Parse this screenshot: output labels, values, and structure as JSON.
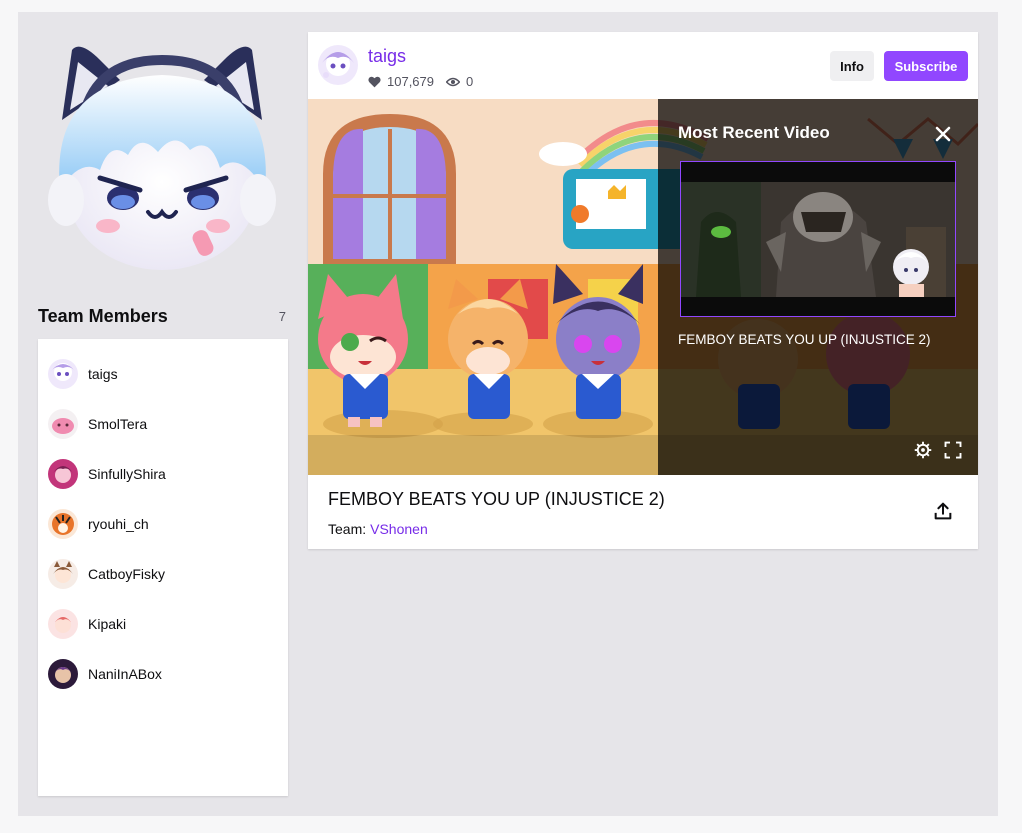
{
  "team": {
    "members_heading": "Team Members",
    "members_count": "7",
    "members": [
      {
        "name": "taigs",
        "avatar_color": "#d8c8f0"
      },
      {
        "name": "SmolTera",
        "avatar_color": "#f08bb0"
      },
      {
        "name": "SinfullyShira",
        "avatar_color": "#c2357a"
      },
      {
        "name": "ryouhi_ch",
        "avatar_color": "#e8742a"
      },
      {
        "name": "CatboyFisky",
        "avatar_color": "#e0b89a"
      },
      {
        "name": "Kipaki",
        "avatar_color": "#e66a6a"
      },
      {
        "name": "NaniInABox",
        "avatar_color": "#6a3a8a"
      }
    ]
  },
  "channel": {
    "name": "taigs",
    "followers": "107,679",
    "viewers": "0",
    "info_label": "Info",
    "subscribe_label": "Subscribe"
  },
  "overlay": {
    "heading": "Most Recent Video",
    "video_title": "FEMBOY BEATS YOU UP (INJUSTICE 2)"
  },
  "stream_info": {
    "title": "FEMBOY BEATS YOU UP (INJUSTICE 2)",
    "team_label": "Team:",
    "team_name": "VShonen"
  },
  "colors": {
    "accent": "#9147ff",
    "link": "#772ce8",
    "page_bg": "#e6e5e9"
  },
  "icons": {
    "heart": "heart-icon",
    "eye": "eye-icon",
    "close": "close-icon",
    "gear": "gear-icon",
    "fullscreen": "fullscreen-icon",
    "share": "share-icon"
  }
}
